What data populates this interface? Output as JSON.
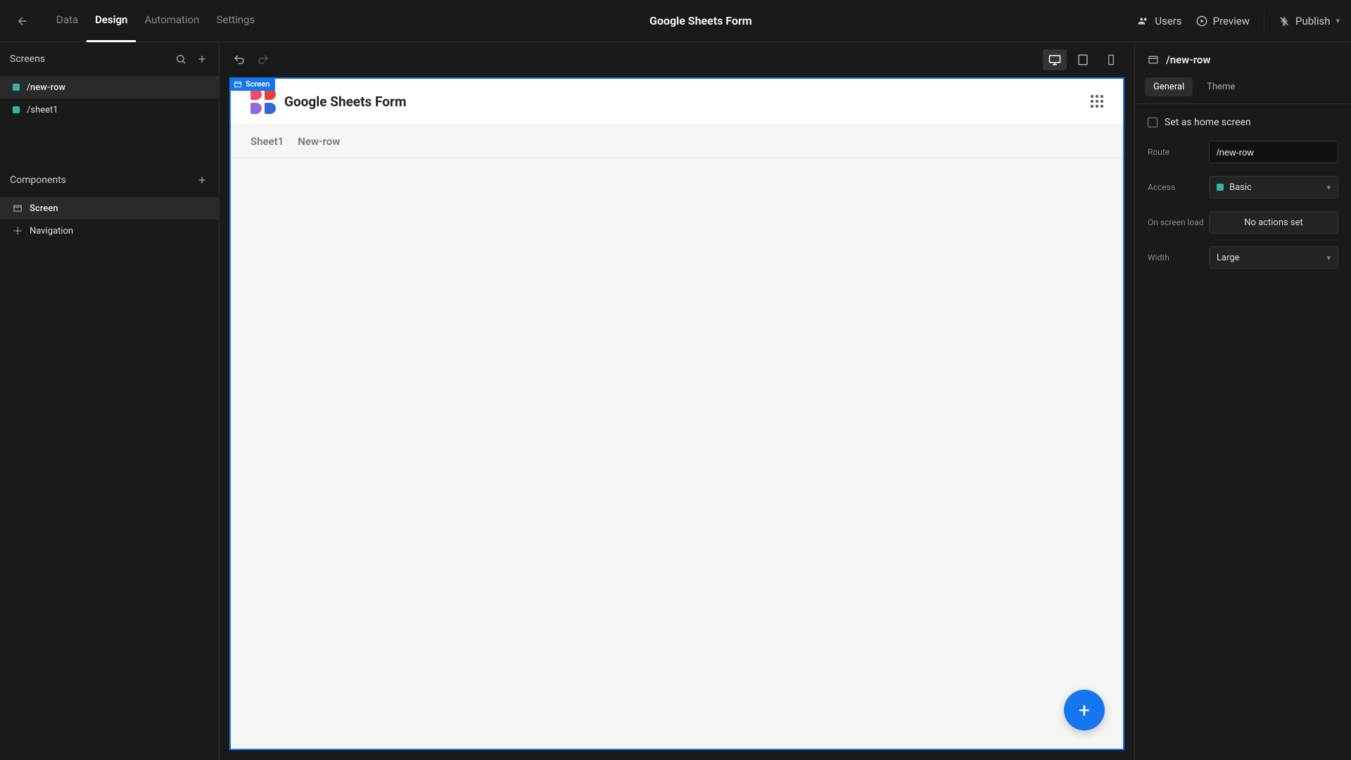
{
  "topbar": {
    "tabs": [
      "Data",
      "Design",
      "Automation",
      "Settings"
    ],
    "active_tab_index": 1,
    "title": "Google Sheets Form",
    "users_label": "Users",
    "preview_label": "Preview",
    "publish_label": "Publish"
  },
  "left": {
    "screens_header": "Screens",
    "screens": [
      {
        "label": "/new-row",
        "active": true
      },
      {
        "label": "/sheet1",
        "active": false
      }
    ],
    "components_header": "Components",
    "components": [
      {
        "label": "Screen",
        "icon": "window",
        "active": true
      },
      {
        "label": "Navigation",
        "icon": "nav",
        "active": false
      }
    ]
  },
  "canvas": {
    "screen_tag": "Screen",
    "app_title": "Google Sheets Form",
    "tabs": [
      "Sheet1",
      "New-row"
    ]
  },
  "right": {
    "title": "/new-row",
    "tabs": [
      "General",
      "Theme"
    ],
    "active_tab_index": 0,
    "home_screen_label": "Set as home screen",
    "fields": {
      "route": {
        "label": "Route",
        "value": "/new-row"
      },
      "access": {
        "label": "Access",
        "value": "Basic"
      },
      "on_screen_load": {
        "label": "On screen load",
        "value": "No actions set"
      },
      "width": {
        "label": "Width",
        "value": "Large"
      }
    }
  }
}
